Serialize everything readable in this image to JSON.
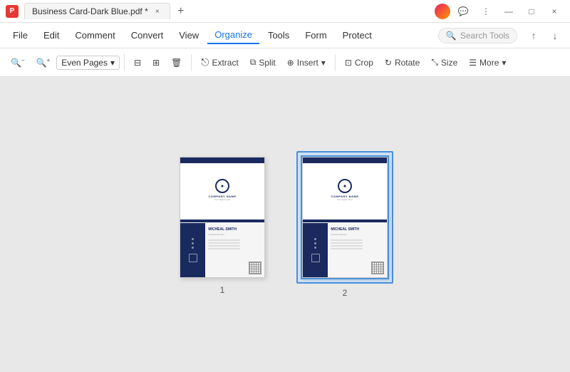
{
  "titleBar": {
    "appIcon": "P",
    "tabTitle": "Business Card-Dark Blue.pdf *",
    "closeTab": "×",
    "newTab": "+",
    "windowControls": {
      "chat": "💬",
      "more": "⋮",
      "minimize": "—",
      "maximize": "□",
      "close": "×"
    }
  },
  "menuBar": {
    "items": [
      {
        "id": "file",
        "label": "File"
      },
      {
        "id": "edit",
        "label": "Edit"
      },
      {
        "id": "comment",
        "label": "Comment"
      },
      {
        "id": "convert",
        "label": "Convert"
      },
      {
        "id": "view",
        "label": "View"
      },
      {
        "id": "organize",
        "label": "Organize",
        "active": true
      },
      {
        "id": "tools",
        "label": "Tools"
      },
      {
        "id": "form",
        "label": "Form"
      },
      {
        "id": "protect",
        "label": "Protect"
      }
    ],
    "searchPlaceholder": "Search Tools"
  },
  "toolbar": {
    "zoomOut": "−",
    "zoomIn": "+",
    "pageFilter": "Even Pages",
    "splitView": "⊟",
    "thumbnail": "⊞",
    "delete": "🗑",
    "extract": "Extract",
    "split": "Split",
    "insert": "Insert",
    "crop": "Crop",
    "rotate": "Rotate",
    "size": "Size",
    "more": "More"
  },
  "pages": [
    {
      "id": 1,
      "label": "1",
      "selected": false
    },
    {
      "id": 2,
      "label": "2",
      "selected": true
    }
  ],
  "colors": {
    "accent": "#1a73e8",
    "selected": "#4a90d9",
    "cardDark": "#1a2a5e",
    "activeTab": "#1a73e8"
  }
}
